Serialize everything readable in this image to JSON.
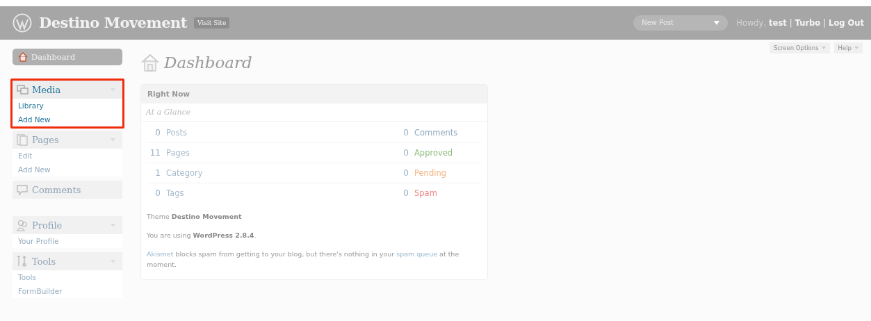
{
  "header": {
    "site_title": "Destino Movement",
    "visit_site": "Visit Site",
    "new_post": "New Post",
    "greeting": "Howdy,",
    "user": "test",
    "separator": "|",
    "links": [
      "Turbo",
      "Log Out"
    ]
  },
  "screen_tabs": [
    "Screen Options",
    "Help"
  ],
  "menu": [
    {
      "kind": "top",
      "label": "Dashboard",
      "selected": true
    },
    {
      "kind": "separator"
    },
    {
      "kind": "group",
      "label": "Media",
      "active": true,
      "highlighted": true,
      "expanded": true,
      "children": [
        "Library",
        "Add New"
      ]
    },
    {
      "kind": "group",
      "label": "Pages",
      "active": false,
      "highlighted": false,
      "expanded": true,
      "children": [
        "Edit",
        "Add New"
      ]
    },
    {
      "kind": "group",
      "label": "Comments",
      "active": false,
      "highlighted": false,
      "expanded": false
    },
    {
      "kind": "separator"
    },
    {
      "kind": "group",
      "label": "Profile",
      "active": false,
      "highlighted": false,
      "expanded": true,
      "children": [
        "Your Profile"
      ]
    },
    {
      "kind": "group",
      "label": "Tools",
      "active": false,
      "highlighted": false,
      "expanded": true,
      "children": [
        "Tools",
        "FormBuilder"
      ]
    }
  ],
  "page_title": "Dashboard",
  "right_now": {
    "title": "Right Now",
    "subtitle": "At a Glance",
    "content": [
      {
        "count": "0",
        "label": "Posts"
      },
      {
        "count": "11",
        "label": "Pages"
      },
      {
        "count": "1",
        "label": "Category"
      },
      {
        "count": "0",
        "label": "Tags"
      }
    ],
    "discussion": [
      {
        "count": "0",
        "label": "Comments",
        "color": "#8fa8bd"
      },
      {
        "count": "0",
        "label": "Approved",
        "color": "#8fbf7f"
      },
      {
        "count": "0",
        "label": "Pending",
        "color": "#f2b27e"
      },
      {
        "count": "0",
        "label": "Spam",
        "color": "#f08585"
      }
    ],
    "theme": "Theme **Destino Movement**",
    "version": "You are using **WordPress 2.8.4**.",
    "akismet": [
      {
        "text": "Akismet",
        "link": true
      },
      {
        "text": " blocks spam from getting to your blog, but there's nothing in your ",
        "link": false
      },
      {
        "text": "spam queue",
        "link": true
      },
      {
        "text": " at the moment.",
        "link": false
      }
    ]
  }
}
